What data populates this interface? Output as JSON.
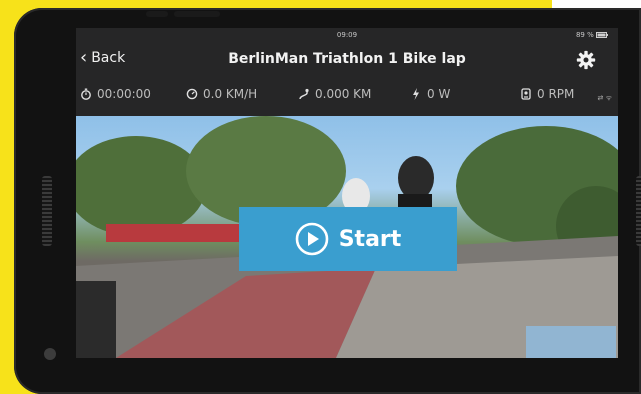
{
  "status": {
    "time": "09:09",
    "battery": "89 %"
  },
  "nav": {
    "back_label": "Back",
    "title": "BerlinMan Triathlon 1 Bike lap"
  },
  "metrics": {
    "time": "00:00:00",
    "speed": "0.0 KM/H",
    "distance": "0.000 KM",
    "power": "0 W",
    "cadence": "0 RPM"
  },
  "video": {
    "start_label": "Start"
  },
  "icons": {
    "settings": "gear-icon",
    "play": "play-circle-icon",
    "stopwatch": "stopwatch-icon",
    "speedometer": "speedometer-icon",
    "distance": "route-icon",
    "power": "lightning-icon",
    "cadence": "cadence-icon"
  },
  "colors": {
    "start_button": "#3a9ecf",
    "frame_background": "#f7e21a",
    "screen_background": "#262627"
  }
}
